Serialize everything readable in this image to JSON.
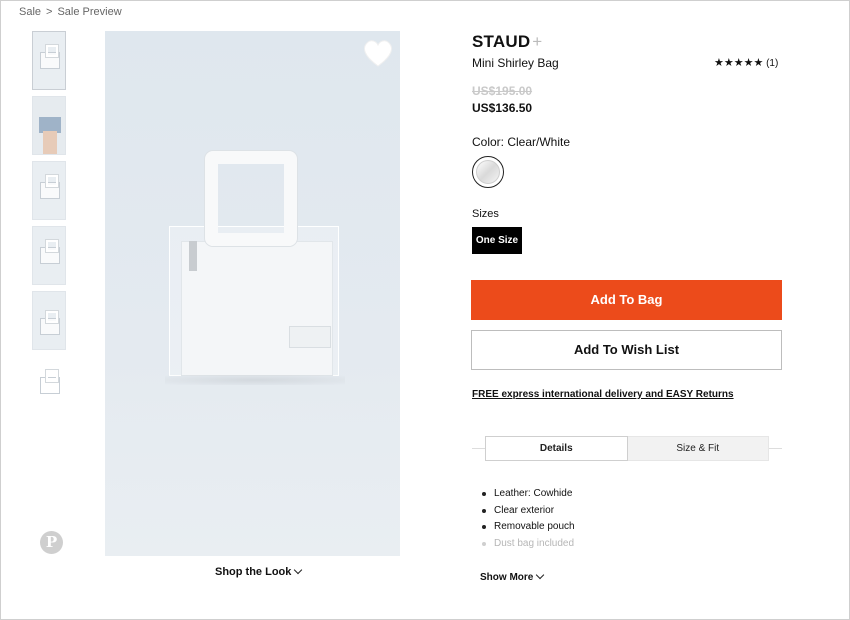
{
  "breadcrumb": {
    "items": [
      "Sale",
      "Sale Preview"
    ],
    "separator": ">"
  },
  "gallery": {
    "thumbnails": [
      "bag-front",
      "bag-worn",
      "bag-side",
      "bag-angle",
      "bag-top",
      "bag-small"
    ],
    "selected_index": 0
  },
  "main_image": {
    "alt_subject": "bag",
    "wishlist_icon": "heart-icon"
  },
  "shop_look": {
    "label": "Shop the Look"
  },
  "product": {
    "brand": "STAUD",
    "brand_plus": "+",
    "name": "Mini Shirley Bag",
    "rating": {
      "stars": 5,
      "stars_text": "★★★★★",
      "count_text": "(1)"
    },
    "original_price": "US$195.00",
    "sale_price": "US$136.50",
    "color_label": "Color: Clear/White",
    "sizes_label": "Sizes",
    "size_selected": "One Size"
  },
  "actions": {
    "add_to_bag": "Add To Bag",
    "add_to_wishlist": "Add To Wish List",
    "accent_color": "#ec4b1b"
  },
  "delivery_link": "FREE express international delivery and EASY Returns",
  "tabs": [
    {
      "label": "Details",
      "active": true
    },
    {
      "label": "Size & Fit",
      "active": false
    }
  ],
  "details": {
    "items": [
      "Leather: Cowhide",
      "Clear exterior",
      "Removable pouch",
      "Dust bag included"
    ],
    "show_more": "Show More"
  },
  "social": {
    "pinterest_icon": "pinterest-icon",
    "pinterest_text": "P"
  }
}
